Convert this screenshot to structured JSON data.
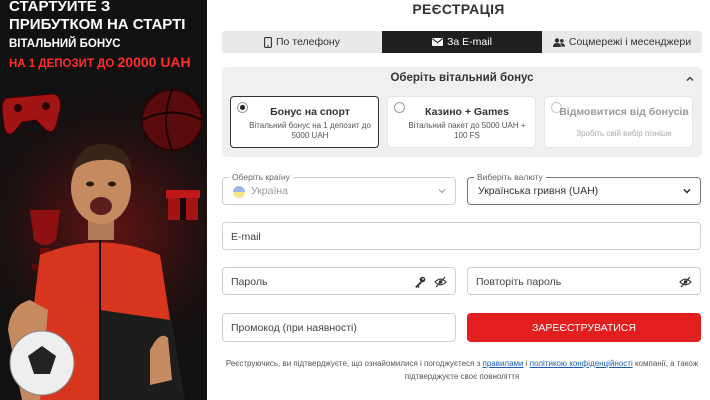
{
  "banner": {
    "headline": "СТАРТУЙТЕ З ПРИБУТКОМ НА СТАРТІ",
    "subtitle": "ВІТАЛЬНИЙ БОНУС",
    "deposit_prefix": "НА 1 ДЕПОЗИТ ДО",
    "deposit_amount": "20000 UAH"
  },
  "form": {
    "title": "РЕЄСТРАЦІЯ",
    "tabs": [
      {
        "label": "По телефону",
        "icon": "phone-icon",
        "active": false
      },
      {
        "label": "За E-mail",
        "icon": "envelope-icon",
        "active": true
      },
      {
        "label": "Соцмережі і месенджери",
        "icon": "users-icon",
        "active": false
      }
    ],
    "bonus": {
      "heading": "Оберіть вітальний бонус",
      "options": [
        {
          "title": "Бонус на спорт",
          "desc": "Вітальний бонус на 1 депозит до 5000 UAH",
          "selected": true
        },
        {
          "title": "Казино + Games",
          "desc": "Вітальний пакет до 5000 UAH + 100 FS",
          "selected": false
        },
        {
          "title": "Відмовитися від бонусів",
          "desc": "Зробіть свій вибір пізніше",
          "selected": false
        }
      ]
    },
    "country": {
      "label": "Оберіть країну",
      "value": "Україна"
    },
    "currency": {
      "label": "Виберіть валюту",
      "value": "Українська гривня (UAH)"
    },
    "email": {
      "placeholder": "E-mail"
    },
    "password": {
      "placeholder": "Пароль"
    },
    "password_repeat": {
      "placeholder": "Повторіть пароль"
    },
    "promo": {
      "placeholder": "Промокод (при наявності)"
    },
    "submit_label": "ЗАРЕЄСТРУВАТИСЯ",
    "terms": {
      "prefix": "Реєструючись, ви підтверджуєте, що ознайомилися і погоджуєтеся з",
      "rules_link": "правилами",
      "and": "і",
      "privacy_link": "політикою конфіденційності",
      "suffix": "компанії, а також підтверджуєте своє повноліття"
    }
  },
  "colors": {
    "accent_red": "#e31e1e",
    "dark": "#1f1f1f",
    "link": "#1a5fb4"
  }
}
